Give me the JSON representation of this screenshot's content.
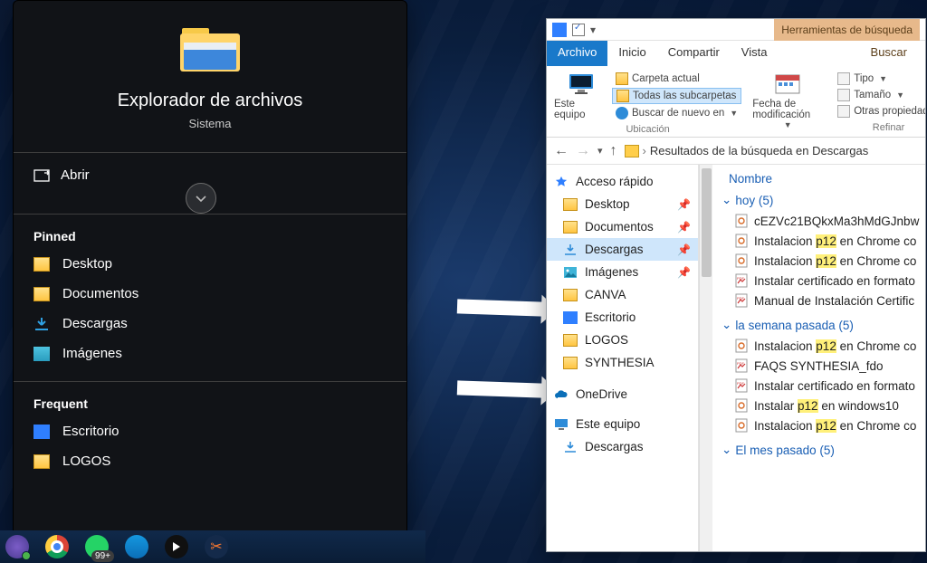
{
  "start": {
    "title": "Explorador de archivos",
    "subtitle": "Sistema",
    "open": "Abrir",
    "pinned_label": "Pinned",
    "pinned": [
      {
        "label": "Desktop",
        "icon": "folder"
      },
      {
        "label": "Documentos",
        "icon": "folder"
      },
      {
        "label": "Descargas",
        "icon": "downloads"
      },
      {
        "label": "Imágenes",
        "icon": "pictures"
      }
    ],
    "frequent_label": "Frequent",
    "frequent": [
      {
        "label": "Escritorio",
        "icon": "desktop"
      },
      {
        "label": "LOGOS",
        "icon": "folder"
      }
    ]
  },
  "taskbar": {
    "whatsapp_badge": "99+"
  },
  "explorer": {
    "title_tools": "Herramientas de búsqueda",
    "menu": {
      "archivo": "Archivo",
      "inicio": "Inicio",
      "compartir": "Compartir",
      "vista": "Vista",
      "buscar": "Buscar"
    },
    "ribbon": {
      "este_equipo": "Este equipo",
      "carpeta_actual": "Carpeta actual",
      "todas_sub": "Todas las subcarpetas",
      "buscar_de_nuevo": "Buscar de nuevo en",
      "ubicacion": "Ubicación",
      "fecha": "Fecha de modificación",
      "tipo": "Tipo",
      "tamano": "Tamaño",
      "otras": "Otras propiedades",
      "refinar": "Refinar"
    },
    "breadcrumb": "Resultados de la búsqueda en Descargas",
    "col_nombre": "Nombre",
    "tree": {
      "acceso": "Acceso rápido",
      "items": [
        {
          "label": "Desktop",
          "pin": true,
          "icon": "folder"
        },
        {
          "label": "Documentos",
          "pin": true,
          "icon": "folder"
        },
        {
          "label": "Descargas",
          "pin": true,
          "icon": "downloads",
          "selected": true
        },
        {
          "label": "Imágenes",
          "pin": true,
          "icon": "pictures"
        },
        {
          "label": "CANVA",
          "icon": "folder"
        },
        {
          "label": "Escritorio",
          "icon": "desktop"
        },
        {
          "label": "LOGOS",
          "icon": "folder"
        },
        {
          "label": "SYNTHESIA",
          "icon": "folder"
        }
      ],
      "onedrive": "OneDrive",
      "este_equipo": "Este equipo",
      "descargas2": "Descargas"
    },
    "groups": [
      {
        "label": "hoy (5)",
        "items": [
          {
            "icon": "html",
            "text": "cEZVc21BQkxMa3hMdGJnbw"
          },
          {
            "icon": "html",
            "text": "Instalacion ",
            "hl": "p12",
            "tail": " en Chrome co"
          },
          {
            "icon": "html",
            "text": "Instalacion ",
            "hl": "p12",
            "tail": " en Chrome co"
          },
          {
            "icon": "pdf",
            "text": "Instalar certificado en formato"
          },
          {
            "icon": "pdf",
            "text": "Manual de Instalación Certific"
          }
        ]
      },
      {
        "label": "la semana pasada (5)",
        "items": [
          {
            "icon": "html",
            "text": "Instalacion ",
            "hl": "p12",
            "tail": " en Chrome co"
          },
          {
            "icon": "pdf",
            "text": "FAQS SYNTHESIA_fdo"
          },
          {
            "icon": "pdf",
            "text": "Instalar certificado en formato"
          },
          {
            "icon": "html",
            "text": "Instalar ",
            "hl": "p12",
            "tail": " en windows10"
          },
          {
            "icon": "html",
            "text": "Instalacion ",
            "hl": "p12",
            "tail": " en Chrome co"
          }
        ]
      },
      {
        "label": "El mes pasado (5)",
        "items": []
      }
    ]
  }
}
